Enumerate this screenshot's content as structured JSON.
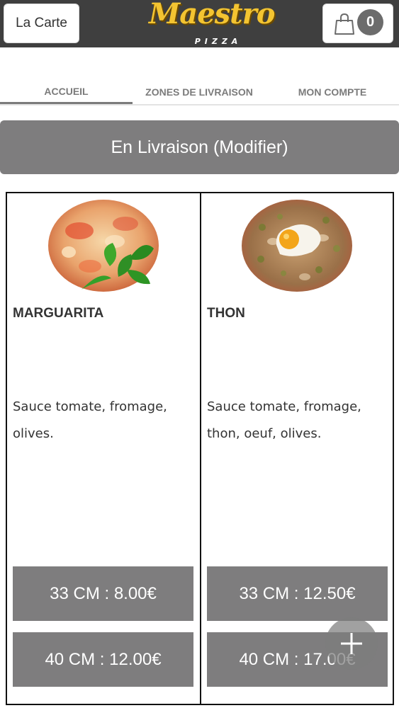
{
  "header": {
    "menu_label": "La Carte",
    "logo_main": "Maestro",
    "logo_sub": "PIZZA",
    "cart_icon": "shopping-bag-icon",
    "cart_count": "0"
  },
  "tabs": [
    {
      "label": "ACCUEIL",
      "active": true
    },
    {
      "label": "ZONES DE LIVRAISON",
      "active": false
    },
    {
      "label": "MON COMPTE",
      "active": false
    }
  ],
  "mode_button": "En Livraison (Modifier)",
  "products": [
    {
      "name": "MARGUARITA",
      "description": "Sauce tomate, fromage, olives.",
      "prices": [
        "33 CM : 8.00€",
        "40 CM : 12.00€"
      ]
    },
    {
      "name": "THON",
      "description": "Sauce tomate, fromage, thon, oeuf, olives.",
      "prices": [
        "33 CM : 12.50€",
        "40 CM : 17.00€"
      ]
    }
  ],
  "fab_icon": "plus-icon",
  "colors": {
    "header_bg": "#3f3f3f",
    "accent_gray": "#7e7d7e",
    "logo_yellow": "#f3c431"
  }
}
